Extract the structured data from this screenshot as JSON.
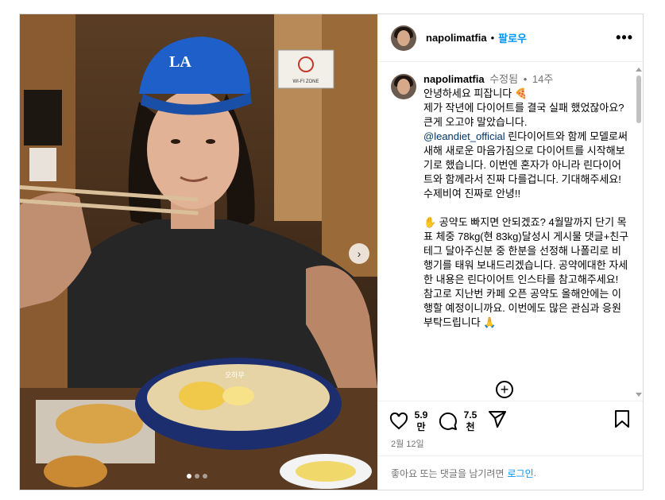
{
  "post": {
    "username": "napolimatfia",
    "follow_label": "팔로우",
    "separator": "•",
    "more_label": "•••"
  },
  "caption": {
    "username": "napolimatfia",
    "edited_label": "수정됨",
    "bullet": "•",
    "time": "14주",
    "text_before_mention": "안녕하세요 피잡니다 🍕\n제가 작년에 다이어트를 결국 실패 했었잖아요? 큰게 오고야 말았습니다.\n",
    "mention": "@leandiet_official",
    "text_after_mention": " 린다이어트와 함께 모델로써 새해 새로운 마음가짐으로 다이어트를 시작해보기로 했습니다. 이번엔 혼자가 아니라 린다이어트와 함께라서 진짜 다를겁니다. 기대해주세요! 수제비여 진짜로 안녕!!\n\n✋ 공약도 빠지면 안되겠죠? 4월말까지 단기 목표 체중 78kg(현 83kg)달성시 게시물 댓글+친구테그 달아주신분 중 한분을 선정해 나폴리로 비행기를 태워 보내드리겠습니다. 공약에대한 자세한 내용은 린다이어트 인스타를 참고해주세요! 참고로 지난번 카페 오픈 공약도 올해안에는 이행할 예정이니까요. 이번에도 많은 관심과 응원 부탁드립니다 🙏"
  },
  "actions": {
    "likes": "5.9\n만",
    "comments": "7.5\n천",
    "date": "2월 12일"
  },
  "login_bar": {
    "prefix": "좋아요 또는 댓글을 남기려면",
    "link": "로그인",
    "suffix": "."
  },
  "photo": {
    "cap_logo_text": "LA",
    "bowl_label": "오하무",
    "wifi_sign": "WI-FI ZONE"
  },
  "carousel": {
    "total": 3,
    "active": 0
  }
}
